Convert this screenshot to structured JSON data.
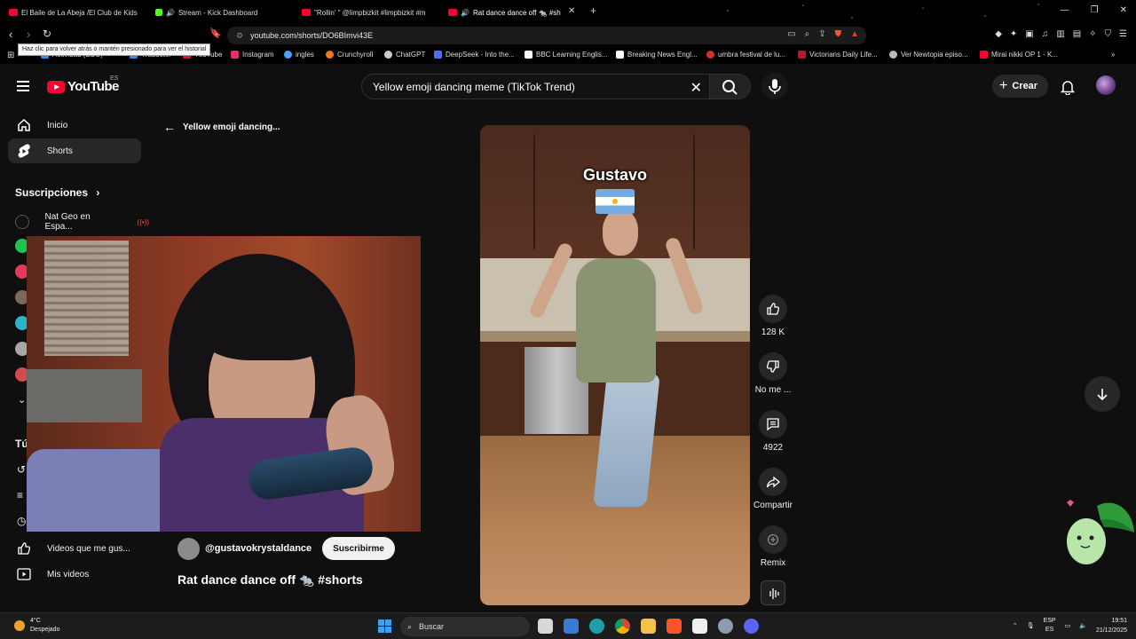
{
  "browser": {
    "tabs": [
      {
        "title": "El Baile de La Abeja /El Club de Kids",
        "favicon_color": "#ff0033"
      },
      {
        "title": "Stream - Kick Dashboard",
        "favicon_color": "#53fc18"
      },
      {
        "title": "\"Rollin' \" @limpbizkit #limpbizkit #m",
        "favicon_color": "#ff0033"
      },
      {
        "title": "Rat dance dance off 🐀 #sh",
        "favicon_color": "#ff0033"
      }
    ],
    "url": "youtube.com/shorts/DO6BImvi43E",
    "tooltip": "Haz clic para volver atrás o mantén presionado para ver el historial",
    "bookmarks": [
      {
        "label": "Actividad (ESO)",
        "color": "#2f8cff"
      },
      {
        "label": "Traductor",
        "color": "#4285f4"
      },
      {
        "label": "YouTube",
        "color": "#ff0033"
      },
      {
        "label": "Instagram",
        "color": "#e1306c"
      },
      {
        "label": "ingles",
        "color": "#4aa3ff"
      },
      {
        "label": "Crunchyroll",
        "color": "#f47521"
      },
      {
        "label": "ChatGPT",
        "color": "#cccccc"
      },
      {
        "label": "DeepSeek - Into the...",
        "color": "#4d6bfe"
      },
      {
        "label": "BBC Learning Englis...",
        "color": "#ffffff"
      },
      {
        "label": "Breaking News Engl...",
        "color": "#ffffff"
      },
      {
        "label": "umbra festival de lu...",
        "color": "#d03030"
      },
      {
        "label": "Victorians Daily Life...",
        "color": "#c0142d"
      },
      {
        "label": "Ver Newtopia episo...",
        "color": "#bbbbbb"
      },
      {
        "label": "Mirai nikki OP 1 - K...",
        "color": "#ff0033"
      }
    ]
  },
  "youtube": {
    "logo": "YouTube",
    "region": "ES",
    "search_query": "Yellow emoji dancing meme (TikTok Trend)",
    "create_label": "Crear",
    "sidebar": {
      "home": "Inicio",
      "shorts": "Shorts",
      "subscriptions_title": "Suscripciones",
      "subscription_first": "Nat Geo en Espa...",
      "you_title": "Tú",
      "liked": "Videos que me gus...",
      "my_videos": "Mis videos"
    },
    "back_label": "Yellow emoji dancing...",
    "short": {
      "channel": "@gustavokrystaldance",
      "subscribe": "Suscribirme",
      "title": "Rat dance dance off 🐀 #shorts",
      "caption": "Gustavo",
      "likes": "128 K",
      "dislike_label": "No me ...",
      "comments": "4922",
      "share_label": "Compartir",
      "remix_label": "Remix"
    }
  },
  "taskbar": {
    "temperature": "4°C",
    "weather": "Despejado",
    "search": "Buscar",
    "lang": "ESP",
    "lang_sub": "ES",
    "time": "19:51",
    "date": "21/12/2025"
  },
  "colors": {
    "accent": "#ff0033",
    "background": "#0f0f0f",
    "chip": "#272727"
  }
}
